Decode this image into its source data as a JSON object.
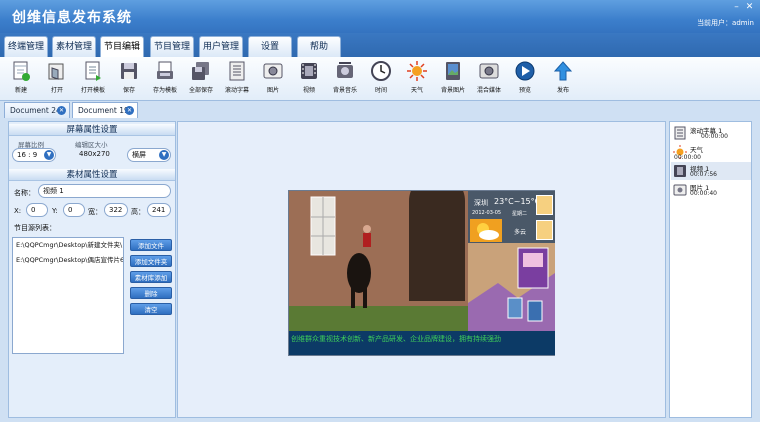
{
  "app": {
    "title": "创维信息发布系统",
    "current_user_label": "当前用户：admin",
    "window_controls": [
      "minimize-icon",
      "close-icon"
    ]
  },
  "menu": {
    "tabs": [
      {
        "label": "终端管理"
      },
      {
        "label": "素材管理"
      },
      {
        "label": "节目编辑",
        "active": true
      },
      {
        "label": "节目管理"
      },
      {
        "label": "用户管理"
      },
      {
        "label": "设置"
      },
      {
        "label": "帮助"
      }
    ]
  },
  "toolbar": {
    "items": [
      {
        "label": "新建",
        "icon": "new-doc-icon"
      },
      {
        "label": "打开",
        "icon": "open-icon"
      },
      {
        "label": "打开模板",
        "icon": "open-template-icon"
      },
      {
        "label": "保存",
        "icon": "save-icon"
      },
      {
        "label": "存为模板",
        "icon": "save-template-icon"
      },
      {
        "label": "全部保存",
        "icon": "save-all-icon"
      },
      {
        "label": "滚动字幕",
        "icon": "scroll-text-icon"
      },
      {
        "label": "图片",
        "icon": "image-icon"
      },
      {
        "label": "视频",
        "icon": "video-icon"
      },
      {
        "label": "背景音乐",
        "icon": "music-icon"
      },
      {
        "label": "时间",
        "icon": "clock-icon"
      },
      {
        "label": "天气",
        "icon": "weather-icon"
      },
      {
        "label": "背景图片",
        "icon": "background-image-icon"
      },
      {
        "label": "混合媒体",
        "icon": "mixed-media-icon"
      },
      {
        "label": "预览",
        "icon": "preview-icon"
      },
      {
        "label": "发布",
        "icon": "publish-icon"
      }
    ]
  },
  "documents": {
    "tabs": [
      {
        "label": "Document 24"
      },
      {
        "label": "Document 19",
        "active": true
      }
    ]
  },
  "screen_props": {
    "header": "屏幕属性设置",
    "ratio_label": "屏幕比例",
    "ratio_value": "16 : 9",
    "area_label": "编辑区大小",
    "area_value": "480x270",
    "orientation_value": "横屏"
  },
  "material_props": {
    "header": "素材属性设置",
    "name_label": "名称：",
    "name_value": "视频 1",
    "x_label": "X:",
    "x_value": "0",
    "y_label": "Y:",
    "y_value": "0",
    "width_label": "宽：",
    "width_value": "322",
    "height_label": "高：",
    "height_value": "241",
    "source_list_label": "节目源列表：",
    "sources": [
      "E:\\QQPCmgr\\Desktop\\新建文件夹\\",
      "E:\\QQPCmgr\\Desktop\\偶店宣传片6"
    ],
    "buttons": [
      "添加文件",
      "添加文件夹",
      "素材库添加",
      "删除",
      "清空"
    ]
  },
  "preview": {
    "weather_city": "深圳",
    "weather_temp": "23°C~15°C",
    "weather_date": "2012-03-05",
    "weather_weekday": "星期二",
    "weather_desc": "多云",
    "scroll_text": "创维群众重视技术创新、新产品研发、企业品牌建设，拥有持续强劲"
  },
  "layers": [
    {
      "name": "滚动字幕 1",
      "time": "00:00:00",
      "icon": "scroll-text-icon"
    },
    {
      "name": "天气",
      "time": "00:00:00",
      "icon": "weather-icon"
    },
    {
      "name": "视频 1",
      "time": "00:07:56",
      "icon": "video-icon",
      "selected": true
    },
    {
      "name": "图片 1",
      "time": "00:00:40",
      "icon": "image-icon"
    }
  ],
  "colors": {
    "title_bar": "#3c7fcc",
    "accent": "#2f6fc0",
    "scroll_bg": "#0c3a66",
    "scroll_text": "#3fcf5a",
    "weather_bg": "#4a5868",
    "sun_box": "#f0a020"
  }
}
